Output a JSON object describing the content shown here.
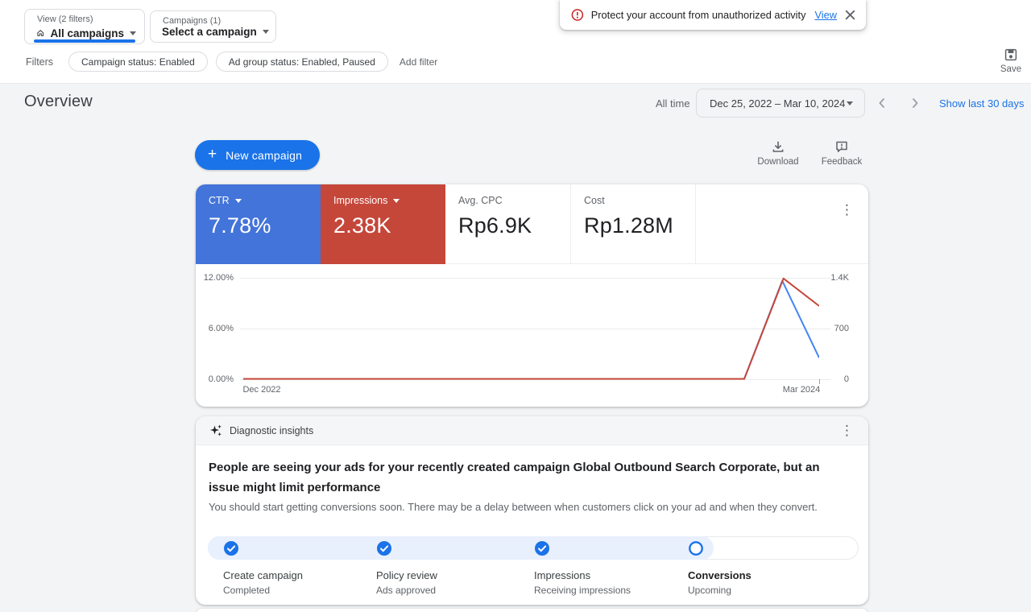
{
  "banner": {
    "text": "Protect your account from unauthorized activity",
    "link_label": "View"
  },
  "toolbar": {
    "view_selector": {
      "label": "View (2 filters)",
      "value": "All campaigns"
    },
    "campaign_selector": {
      "label": "Campaigns (1)",
      "value": "Select a campaign"
    },
    "filters_label": "Filters",
    "filter_chips": [
      "Campaign status: Enabled",
      "Ad group status: Enabled, Paused"
    ],
    "add_filter_label": "Add filter",
    "save_label": "Save"
  },
  "page_header": {
    "title": "Overview",
    "date_preset": "All time",
    "date_range": "Dec 25, 2022 – Mar 10, 2024",
    "date_shortcut": "Show last 30 days"
  },
  "actions": {
    "new_campaign_plus": "+",
    "new_campaign_label": "New campaign",
    "download_label": "Download",
    "feedback_label": "Feedback"
  },
  "scorecards": [
    {
      "label": "CTR",
      "value": "7.78%",
      "selected": true,
      "color": "#4374d9"
    },
    {
      "label": "Impressions",
      "value": "2.38K",
      "selected": true,
      "color": "#c5473a"
    },
    {
      "label": "Avg. CPC",
      "value": "Rp6.9K",
      "selected": false
    },
    {
      "label": "Cost",
      "value": "Rp1.28M",
      "selected": false
    }
  ],
  "kebab_glyph": "⋮",
  "chart_data": {
    "type": "line",
    "title": "",
    "grid": true,
    "x_ticks": [
      "Dec 2022",
      "Mar 2024"
    ],
    "left_axis": {
      "metric": "CTR",
      "ticks": [
        "12.00%",
        "6.00%",
        "0.00%"
      ],
      "min": 0,
      "max": 12
    },
    "right_axis": {
      "metric": "Impressions",
      "ticks": [
        "1.4K",
        "700",
        "0"
      ],
      "min": 0,
      "max": 1400
    },
    "series": [
      {
        "name": "CTR",
        "axis": "left",
        "color": "#4285f4",
        "points": [
          {
            "x": 0,
            "y": 0
          },
          {
            "x": 0.87,
            "y": 0
          },
          {
            "x": 0.936,
            "y": 11.6
          },
          {
            "x": 1,
            "y": 2.5
          }
        ]
      },
      {
        "name": "Impressions",
        "axis": "right",
        "color": "#c5473a",
        "points": [
          {
            "x": 0,
            "y": 0
          },
          {
            "x": 0.87,
            "y": 0
          },
          {
            "x": 0.938,
            "y": 1385
          },
          {
            "x": 1,
            "y": 1005
          }
        ]
      }
    ],
    "note": "Both series flat at 0 from Dec 2022 until early 2024, spiking to a peak just before Mar 2024"
  },
  "insights": {
    "header_label": "Diagnostic insights",
    "title": "People are seeing your ads for your recently created campaign Global Outbound Search Corporate, but an issue might limit performance",
    "subtitle": "You should start getting conversions soon. There may be a delay between when customers click on your ad and when they convert.",
    "steps": [
      {
        "title": "Create campaign",
        "status": "Completed",
        "state": "done"
      },
      {
        "title": "Policy review",
        "status": "Ads approved",
        "state": "done"
      },
      {
        "title": "Impressions",
        "status": "Receiving impressions",
        "state": "done"
      },
      {
        "title": "Conversions",
        "status": "Upcoming",
        "state": "upcoming"
      }
    ]
  },
  "colors": {
    "accent": "#1a73e8",
    "scorecard_blue": "#4374d9",
    "scorecard_red": "#c5473a",
    "line_blue": "#4285f4",
    "alert_red": "#c5221f",
    "background": "#f3f4f5",
    "step_fill": "#e8f0fe"
  }
}
